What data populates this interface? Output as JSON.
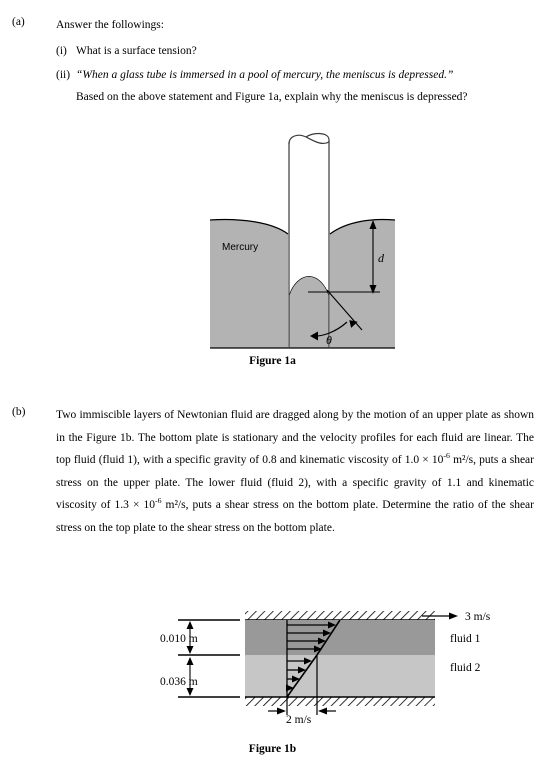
{
  "question": {
    "part_a": {
      "label": "(a)",
      "stem": "Answer the followings:",
      "items": [
        {
          "marker": "(i)",
          "text": "What is a surface tension?"
        },
        {
          "marker": "(ii)",
          "quote": "“When a glass tube is immersed in a pool of mercury, the meniscus is depressed.”",
          "text": "Based on the above statement and Figure 1a, explain why the meniscus is depressed?"
        }
      ]
    },
    "part_b": {
      "label": "(b)",
      "text_run_1": "Two immiscible layers of Newtonian fluid are dragged along by the motion of an upper plate as shown in the Figure 1b. The bottom plate is stationary and the velocity profiles for each fluid are linear. The top fluid (fluid 1), with a specific gravity of 0.8 and kinematic viscosity of 1.0 × 10",
      "exp_1": "-6",
      "text_run_2": " m²/s, puts a shear stress on the upper plate. The lower fluid (fluid 2), with a specific gravity of 1.1 and kinematic viscosity of 1.3 × 10",
      "exp_2": "-6",
      "text_run_3": " m²/s, puts a shear stress on the bottom plate. Determine the ratio of the shear stress on the top plate to the shear stress on the bottom plate."
    }
  },
  "figure_1a": {
    "caption": "Figure 1a",
    "liquid_label": "Mercury",
    "depth_label": "d",
    "angle_label": "θ",
    "fill_color": "#b3b3b3",
    "stroke_color": "#000000"
  },
  "figure_1b": {
    "caption": "Figure 1b",
    "top_velocity_label": "3 m/s",
    "interface_velocity_label": "2 m/s",
    "fluid_1_label": "fluid 1",
    "fluid_2_label": "fluid 2",
    "thickness_1_label": "0.010 m",
    "thickness_2_label": "0.036 m",
    "fluid_1_color": "#999999",
    "fluid_2_color": "#c6c6c6",
    "plate_hatch_color": "#000000"
  }
}
